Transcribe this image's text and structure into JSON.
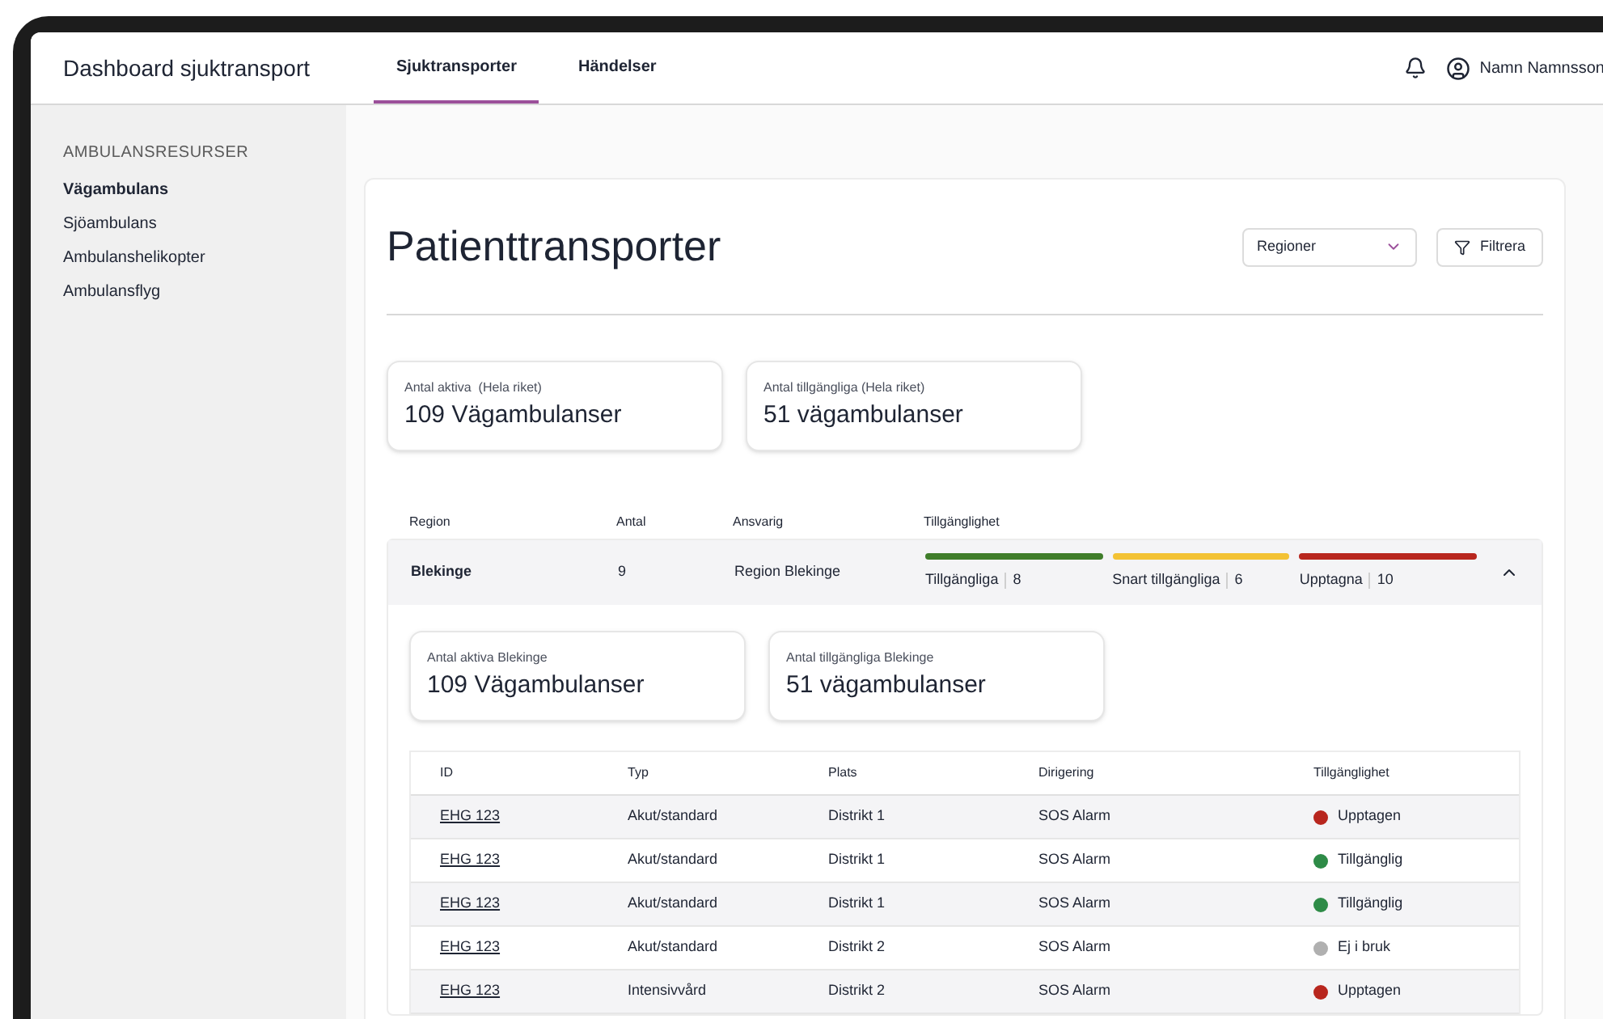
{
  "app": {
    "title": "Dashboard sjuktransport",
    "user": "Namn Namnsson"
  },
  "tabs": [
    {
      "label": "Sjuktransporter",
      "selected": true
    },
    {
      "label": "Händelser",
      "selected": false
    }
  ],
  "sidebar": {
    "heading": "AMBULANSRESURSER",
    "items": [
      {
        "label": "Vägambulans",
        "selected": true
      },
      {
        "label": "Sjöambulans",
        "selected": false
      },
      {
        "label": "Ambulanshelikopter",
        "selected": false
      },
      {
        "label": "Ambulansflyg",
        "selected": false
      }
    ]
  },
  "page": {
    "title": "Patienttransporter",
    "region_select": "Regioner",
    "filter_button": "Filtrera"
  },
  "stats": [
    {
      "label": "Antal aktiva  (Hela riket)",
      "value": "109 Vägambulanser"
    },
    {
      "label": "Antal tillgängliga (Hela riket)",
      "value": "51 vägambulanser"
    }
  ],
  "regions_table": {
    "columns": [
      "Region",
      "Antal",
      "Ansvarig",
      "Tillgänglighet"
    ],
    "rows": [
      {
        "region": "Blekinge",
        "count": "9",
        "responsible": "Region Blekinge",
        "expanded": true,
        "availability": [
          {
            "label": "Tillgängliga",
            "count": "8",
            "color": "#3f7d2a"
          },
          {
            "label": "Snart tillgängliga",
            "count": "6",
            "color": "#f3c234"
          },
          {
            "label": "Upptagna",
            "count": "10",
            "color": "#b8261e"
          }
        ],
        "stats": [
          {
            "label": "Antal aktiva Blekinge",
            "value": "109 Vägambulanser"
          },
          {
            "label": "Antal tillgängliga Blekinge",
            "value": "51 vägambulanser"
          }
        ],
        "vehicles": {
          "columns": [
            "ID",
            "Typ",
            "Plats",
            "Dirigering",
            "Tillgänglighet"
          ],
          "rows": [
            {
              "id": "EHG 123",
              "type": "Akut/standard",
              "location": "Distrikt 1",
              "dispatch": "SOS Alarm",
              "status": "Upptagen",
              "color": "#b8261e"
            },
            {
              "id": "EHG 123",
              "type": "Akut/standard",
              "location": "Distrikt 1",
              "dispatch": "SOS Alarm",
              "status": "Tillgänglig",
              "color": "#2e8b47"
            },
            {
              "id": "EHG 123",
              "type": "Akut/standard",
              "location": "Distrikt 1",
              "dispatch": "SOS Alarm",
              "status": "Tillgänglig",
              "color": "#2e8b47"
            },
            {
              "id": "EHG 123",
              "type": "Akut/standard",
              "location": "Distrikt 2",
              "dispatch": "SOS Alarm",
              "status": "Ej i bruk",
              "color": "#b0b0b0"
            },
            {
              "id": "EHG 123",
              "type": "Intensivvård",
              "location": "Distrikt 2",
              "dispatch": "SOS Alarm",
              "status": "Upptagen",
              "color": "#b8261e"
            }
          ]
        }
      }
    ]
  }
}
